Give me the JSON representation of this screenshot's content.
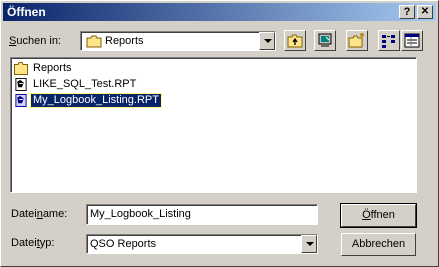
{
  "title": "Öffnen",
  "titlebar": {
    "help_label": "?",
    "close_label": "✕"
  },
  "lookin": {
    "label_accel": "S",
    "label_rest": "uchen in:",
    "value": "Reports",
    "icon": "folder-icon"
  },
  "toolbar": {
    "buttons": [
      {
        "name": "up-folder-icon"
      },
      {
        "name": "desktop-icon"
      },
      {
        "name": "new-folder-icon"
      },
      {
        "name": "list-view-icon"
      },
      {
        "name": "details-view-icon"
      }
    ]
  },
  "files": [
    {
      "name": "Reports",
      "icon": "folder-icon",
      "selected": false
    },
    {
      "name": "LIKE_SQL_Test.RPT",
      "icon": "report-file-icon",
      "selected": false
    },
    {
      "name": "My_Logbook_Listing.RPT",
      "icon": "report-file-icon",
      "selected": true
    }
  ],
  "filename": {
    "label_pre": "Datei",
    "label_accel": "n",
    "label_post": "ame:",
    "value": "My_Logbook_Listing"
  },
  "filetype": {
    "label_pre": "Datei",
    "label_accel": "t",
    "label_post": "yp:",
    "value": "QSO Reports"
  },
  "buttons": {
    "open_accel": "Ö",
    "open_rest": "ffnen",
    "cancel": "Abbrechen"
  },
  "colors": {
    "titlebar_start": "#0a246a",
    "titlebar_end": "#a6caf0",
    "face": "#d4d0c8",
    "selection": "#0a246a"
  }
}
